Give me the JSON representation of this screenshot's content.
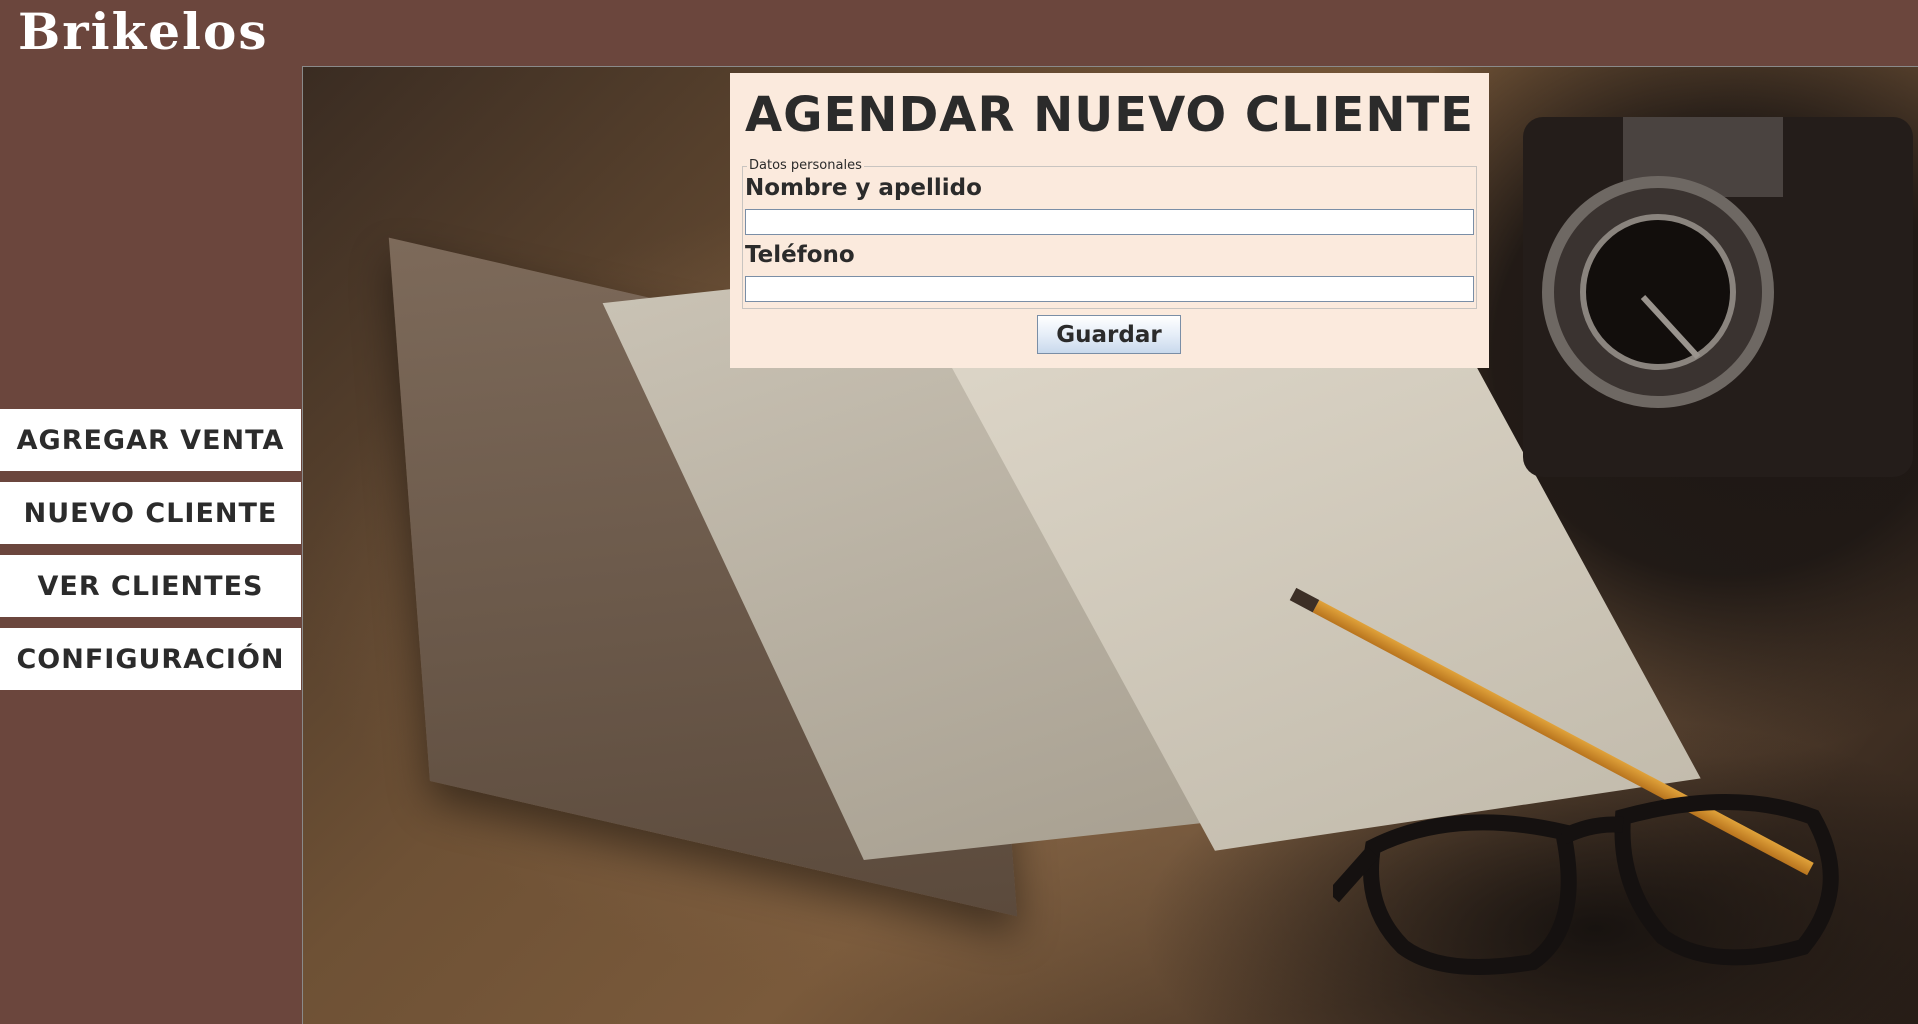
{
  "app": {
    "title": "Brikelos"
  },
  "sidebar": {
    "items": [
      {
        "label": "AGREGAR VENTA"
      },
      {
        "label": "NUEVO CLIENTE"
      },
      {
        "label": "VER CLIENTES"
      },
      {
        "label": "CONFIGURACIÓN"
      }
    ]
  },
  "form": {
    "title": "AGENDAR NUEVO CLIENTE",
    "legend": "Datos personales",
    "fields": [
      {
        "label": "Nombre y apellido",
        "value": "",
        "placeholder": ""
      },
      {
        "label": "Teléfono",
        "value": "",
        "placeholder": ""
      }
    ],
    "save_label": "Guardar"
  },
  "colors": {
    "background": "#6b463d",
    "panel": "#fbeadd",
    "text": "#2b2b2b",
    "button_border": "#7a8ea6"
  }
}
